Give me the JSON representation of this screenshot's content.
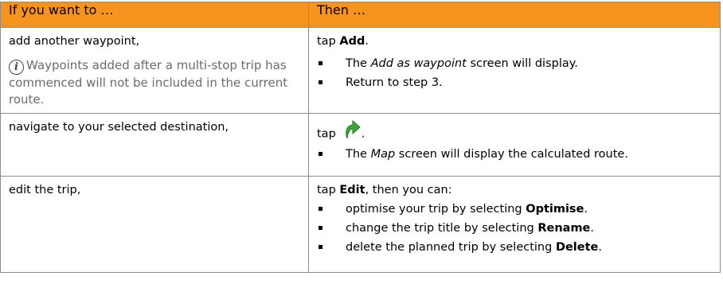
{
  "headers": {
    "col1": "If you want to …",
    "col2": "Then …"
  },
  "rows": [
    {
      "action": "add another waypoint,",
      "note": "Waypoints added after a multi-stop trip has commenced will not be included in the current route.",
      "tap_prefix": "tap",
      "tap_bold": "Add",
      "tap_suffix": ".",
      "bullets": [
        {
          "pre": "The",
          "italic": "Add as waypoint",
          "post": "screen will display."
        },
        {
          "pre": "Return to step 3.",
          "italic": "",
          "post": ""
        }
      ]
    },
    {
      "action": "navigate to your selected destination,",
      "tap_prefix": "tap",
      "tap_suffix": ".",
      "icon": "green-go-arrow-icon",
      "bullets": [
        {
          "pre": "The",
          "italic": "Map",
          "post": "screen will display the calculated route."
        }
      ]
    },
    {
      "action": "edit the trip,",
      "tap_prefix": "tap",
      "tap_bold": "Edit",
      "tap_suffix": ", then you can:",
      "bullets": [
        {
          "pre": "optimise your trip by selecting",
          "bold": "Optimise",
          "post": "."
        },
        {
          "pre": "change the trip title by selecting",
          "bold": "Rename",
          "post": "."
        },
        {
          "pre": "delete the planned trip by selecting",
          "bold": "Delete",
          "post": "."
        }
      ]
    }
  ],
  "colors": {
    "header_bg": "#f7941d",
    "border": "#8c8c8c",
    "note_text": "#6b6b6b",
    "icon_green": "#3aa935"
  }
}
